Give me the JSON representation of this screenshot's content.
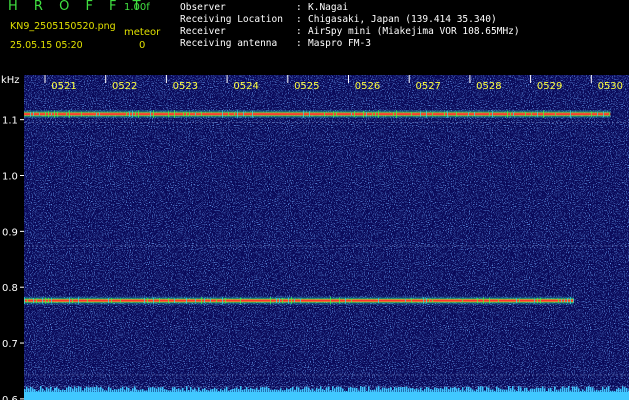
{
  "header": {
    "title": "H R O F F T",
    "version": "1.00f",
    "filename": "KN9_2505150520.png",
    "meteor_label": "meteor",
    "date": "25.05.15 05:20",
    "count": "0",
    "info": [
      {
        "key": "Observer",
        "value": "K.Nagai"
      },
      {
        "key": "Receiving Location",
        "value": "Chigasaki, Japan (139.414 35.340)"
      },
      {
        "key": "Receiver",
        "value": "AirSpy mini (Miakejima VOR 108.65MHz)"
      },
      {
        "key": "Receiving antenna",
        "value": "Maspro FM-3"
      }
    ],
    "separator": ":"
  },
  "chart_data": {
    "type": "heatmap",
    "ylabel": "kHz",
    "ylim": [
      0.598,
      1.18
    ],
    "yticks": [
      0.6,
      0.7,
      0.8,
      0.9,
      1.0,
      1.1
    ],
    "ytick_labels": [
      "0.6",
      "0.7",
      "0.8",
      "0.9",
      "1.0",
      "1.1"
    ],
    "xticks": [
      "0521",
      "0522",
      "0523",
      "0524",
      "0525",
      "0526",
      "0527",
      "0528",
      "0529",
      "0530"
    ],
    "background_color": "#0a0a5a",
    "noise_color": "#2050d0",
    "signal_colors": [
      "#ff3030",
      "#ffb020",
      "#30e0e0",
      "#40ff40"
    ],
    "traces": [
      {
        "freq": 1.11,
        "start": "0520",
        "end": "0530"
      },
      {
        "freq": 0.776,
        "start": "0520",
        "end": "0529.4"
      }
    ],
    "faint_lines": [
      1.095,
      0.874,
      0.643,
      0.622,
      0.603
    ],
    "bottom_band_color": "#40c8ff"
  }
}
